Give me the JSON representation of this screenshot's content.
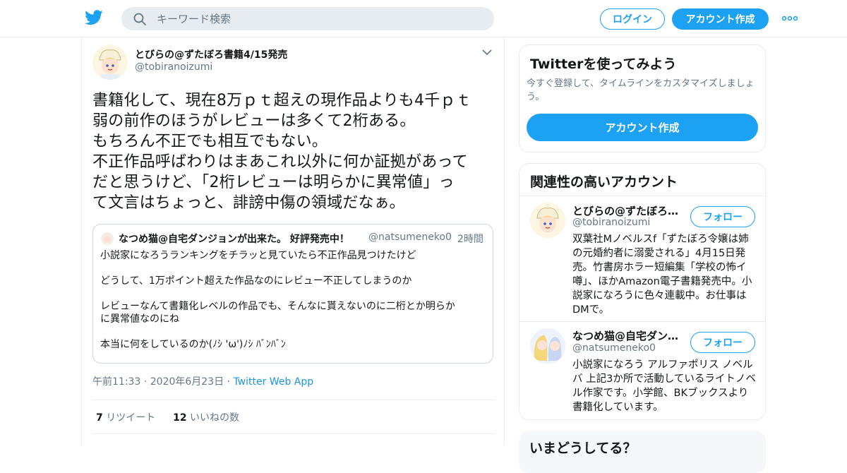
{
  "header": {
    "search_placeholder": "キーワード検索",
    "login_label": "ログイン",
    "signup_label": "アカウント作成"
  },
  "tweet": {
    "author_name": "とびらの@ずたぼろ書籍4/15発売",
    "author_handle": "@tobiranoizumi",
    "text": "書籍化して、現在8万ｐｔ超えの現作品よりも4千ｐｔ\n弱の前作のほうがレビューは多くて2桁ある。\nもちろん不正でも相互でもない。\n不正作品呼ばわりはまあこれ以外に何か証拠があって\nだと思うけど、「2桁レビューは明らかに異常値」っ\nて文言はちょっと、誹謗中傷の領域だなぁ。",
    "quote": {
      "name": "なつめ猫@自宅ダンジョンが出来た。 好評発売中！",
      "handle": "@natsumeneko0",
      "dot": "·",
      "time": "2時間",
      "text": "小説家になろうランキングをチラッと見ていたら不正作品見つけたけど\n\nどうして、1万ポイント超えた作品なのにレビュー不正してしまうのか\n\nレビューなんて書籍化レベルの作品でも、そんなに貰えないのに二桁とか明らか\nに異常値なのにね\n\n本当に何をしているのか(ﾉｼ 'ω')ﾉｼ ﾊﾞﾝﾊﾞﾝ"
    },
    "time": "午前11:33",
    "sep1": " · ",
    "date": "2020年6月23日",
    "sep2": " · ",
    "source": "Twitter Web App",
    "retweet_count": "7",
    "retweet_label": "リツイート",
    "like_count": "12",
    "like_label": "いいねの数"
  },
  "signup_card": {
    "title": "Twitterを使ってみよう",
    "subtitle": "今すぐ登録して、タイムラインをカスタマイズしましょう。",
    "button": "アカウント作成"
  },
  "related": {
    "title": "関連性の高いアカウント",
    "accounts": [
      {
        "name": "とびらの@ずたぼろ…",
        "handle": "@tobiranoizumi",
        "follow": "フォロー",
        "bio": "双葉社Mノベルスf「ずたぼろ令嬢は姉の元婚約者に溺愛される」4月15日発売。竹書房ホラー短編集「学校の怖イ噂」、ほかAmazon電子書籍発売中。小説家になろうに色々連載中。お仕事はDMで。"
      },
      {
        "name": "なつめ猫@自宅ダン…",
        "handle": "@natsumeneko0",
        "follow": "フォロー",
        "bio": "小説家になろう アルファポリス ノベルバ 上記3か所で活動しているライトノベル作家です。小学館、BKブックスより書籍化しています。"
      }
    ]
  },
  "trends_card": {
    "title": "いまどうしてる？"
  },
  "colors": {
    "accent": "#1da1f2",
    "muted": "#657786",
    "border": "#e6ecf0"
  },
  "icons": [
    "twitter-bird-icon",
    "search-icon",
    "more-dots-icon",
    "chevron-down-icon"
  ]
}
